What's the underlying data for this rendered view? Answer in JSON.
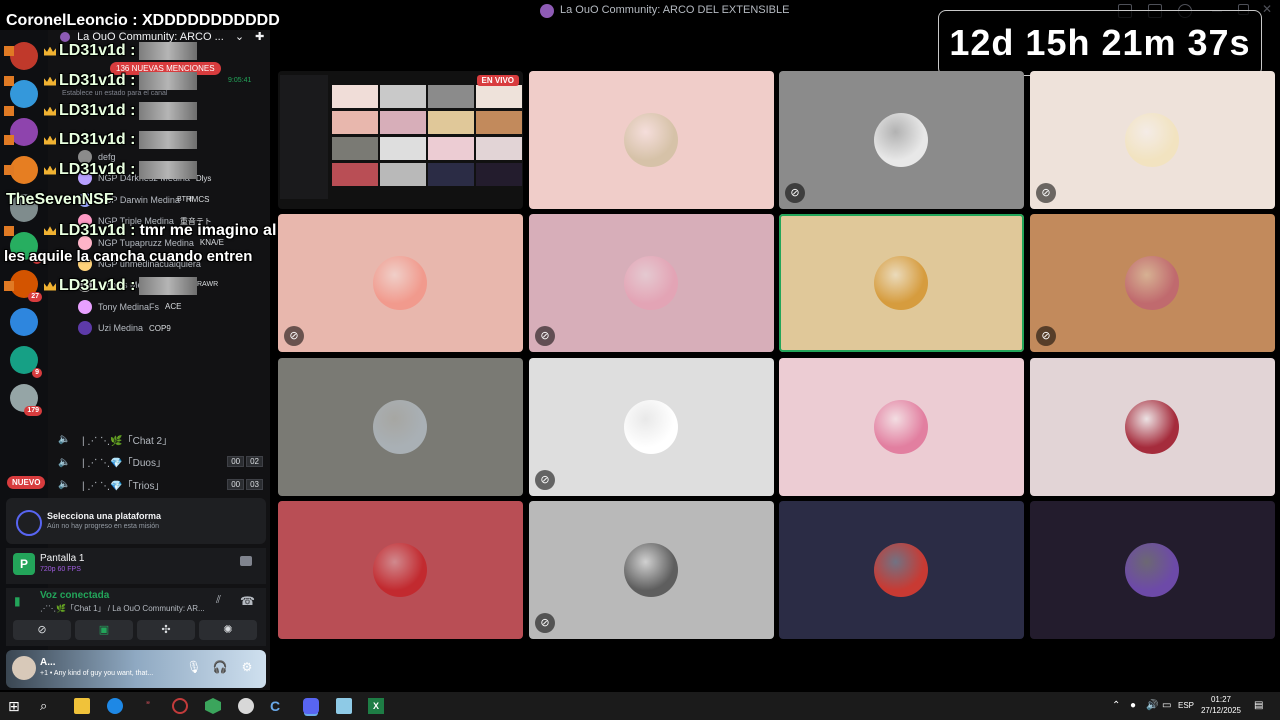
{
  "window": {
    "title": "La OuO Community: ARCO DEL EXTENSIBLE"
  },
  "timer": {
    "text": "12d 15h 21m 37s"
  },
  "sidebar": {
    "server_name": "La OuO Community: ARCO ...",
    "new_mentions": "136 NUEVAS MENCIONES",
    "status_placeholder": "Establece un estado para el canal",
    "time_label": "9:05:41",
    "servers": [
      {
        "badge": ""
      },
      {
        "badge": ""
      },
      {
        "badge": ""
      },
      {
        "badge": ""
      },
      {
        "badge": ""
      },
      {
        "badge": "2"
      },
      {
        "badge": "27"
      },
      {
        "badge": ""
      },
      {
        "badge": "9"
      },
      {
        "badge": "179"
      }
    ],
    "new_label": "NUEVO",
    "members": [
      {
        "name": "defg",
        "tag": ""
      },
      {
        "name": "NGP D4rknesz Medina",
        "tag": "Dlys"
      },
      {
        "name": "NGP Darwin Medina",
        "tag": "HMCS"
      },
      {
        "name": "NGP Triple Medina",
        "tag": "重音テト"
      },
      {
        "name": "NGP Tupapruzz Medina",
        "tag": "KNA/E"
      },
      {
        "name": "NGP unmedinacualquiera",
        "tag": ""
      },
      {
        "name": "Nicolas Medina 2",
        "tag": ""
      },
      {
        "name": "Tony MedinaFs",
        "tag": "ACE"
      },
      {
        "name": "Uzi Medina",
        "tag": "COP9"
      }
    ],
    "voice_channels": [
      {
        "label": "| ⋰ ⋱🌿「Chat 2」",
        "counts": []
      },
      {
        "label": "| ⋰ ⋱💎「Duos」",
        "counts": [
          "00",
          "02"
        ]
      },
      {
        "label": "| ⋰ ⋱💎「Trios」",
        "counts": [
          "00",
          "03"
        ]
      }
    ],
    "extra_tags": {
      "btr": "BTR!",
      "rawr": "RAWR"
    }
  },
  "overlay_chat": {
    "header": "CoronelLeoncio : XDDDDDDDDDDD",
    "messages": [
      {
        "name": "LD31v1d :",
        "text": ""
      },
      {
        "name": "LD31v1d :",
        "text": ""
      },
      {
        "name": "LD31v1d :",
        "text": ""
      },
      {
        "name": "LD31v1d :",
        "text": ""
      },
      {
        "name": "LD31v1d :",
        "text": ""
      },
      {
        "name": "TheSevenNSF",
        "text": ""
      },
      {
        "name": "LD31v1d :",
        "text": "tmr me imagino al tio que"
      },
      {
        "name": "",
        "text": "les aquile la cancha cuando entren"
      },
      {
        "name": "LD31v1d :",
        "text": ""
      }
    ]
  },
  "quest": {
    "title": "Selecciona una plataforma",
    "subtitle": "Aún no hay progreso en esta misión"
  },
  "screen_share": {
    "title": "Pantalla 1",
    "subtitle": "720p 60 FPS",
    "icon_letter": "P"
  },
  "voice": {
    "status": "Voz conectada",
    "channel": "⋰⋱🌿「Chat 1」 / La OuO Community: AR..."
  },
  "user": {
    "name": "A...",
    "status": "+1 • Any kind of guy you want, that..."
  },
  "stream_badge": "EN VIVO",
  "tiles": [
    {
      "bg": "#f0cdc9",
      "avatar": "#d6c2a8",
      "muted": false,
      "speaking": false
    },
    {
      "bg": "#8b8b8b",
      "avatar": "#e8e8e8",
      "muted": true,
      "speaking": false
    },
    {
      "bg": "#eee2da",
      "avatar": "#f2e3c0",
      "muted": true,
      "speaking": false
    },
    {
      "bg": "#e8b7ad",
      "avatar": "#f19a8d",
      "muted": true,
      "speaking": false
    },
    {
      "bg": "#d7aeb9",
      "avatar": "#e3a4b5",
      "muted": true,
      "speaking": false
    },
    {
      "bg": "#e0c899",
      "avatar": "#d69c3e",
      "muted": false,
      "speaking": true
    },
    {
      "bg": "#c28a5c",
      "avatar": "#c06a6e",
      "muted": true,
      "speaking": false
    },
    {
      "bg": "#7a7a74",
      "avatar": "#a9b0b5",
      "muted": false,
      "speaking": false
    },
    {
      "bg": "#dedede",
      "avatar": "#ffffff",
      "muted": true,
      "speaking": false
    },
    {
      "bg": "#ecccd3",
      "avatar": "#e27fa0",
      "muted": false,
      "speaking": false
    },
    {
      "bg": "#e2d4d6",
      "avatar": "#a52c3c",
      "muted": false,
      "speaking": false
    },
    {
      "bg": "#b94e55",
      "avatar": "#c22a2f",
      "muted": false,
      "speaking": false
    },
    {
      "bg": "#b9b9b9",
      "avatar": "#5e5e5e",
      "muted": true,
      "speaking": false
    },
    {
      "bg": "#2b2c45",
      "avatar": "#c83a33",
      "muted": false,
      "speaking": false
    },
    {
      "bg": "#231c2d",
      "avatar": "#6d4aa8",
      "muted": false,
      "speaking": false
    }
  ],
  "taskbar": {
    "lang": "ESP",
    "time": "01:27",
    "date": "27/12/2025"
  }
}
